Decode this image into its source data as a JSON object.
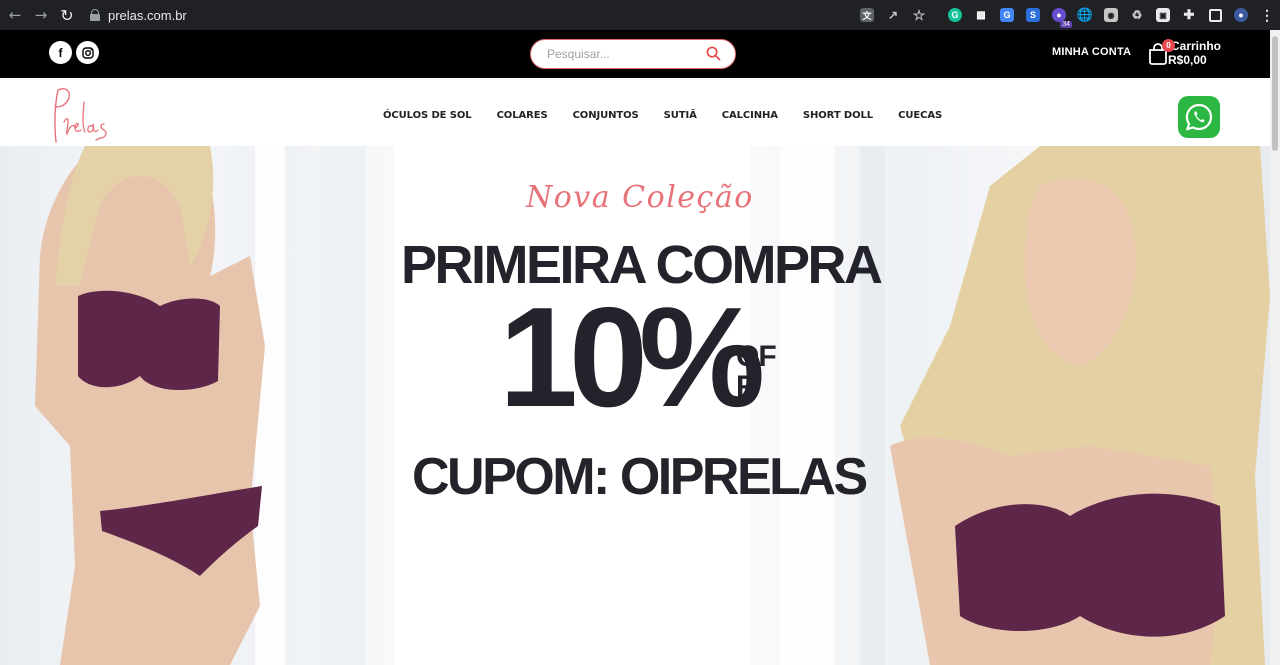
{
  "browser": {
    "url": "prelas.com.br",
    "extension_badge": "34"
  },
  "topbar": {
    "social": [
      "facebook-icon",
      "instagram-icon"
    ],
    "search_placeholder": "Pesquisar...",
    "account_label": "MINHA CONTA",
    "cart_count": "0",
    "cart_label": "Carrinho",
    "cart_total": "R$0,00"
  },
  "header": {
    "logo_text": "Prelas",
    "nav_items": [
      "ÓCULOS DE SOL",
      "COLARES",
      "CONJUNTOS",
      "SUTIÃ",
      "CALCINHA",
      "SHORT DOLL",
      "CUECAS"
    ]
  },
  "hero": {
    "subtitle": "Nova Coleção",
    "headline": "PRIMEIRA COMPRA",
    "discount": "10%",
    "off": "OFF",
    "coupon": "CUPOM: OIPRELAS"
  },
  "colors": {
    "accent": "#e8727a",
    "dark_text": "#23232b",
    "topbar": "#000000",
    "whatsapp": "#2bb741"
  }
}
